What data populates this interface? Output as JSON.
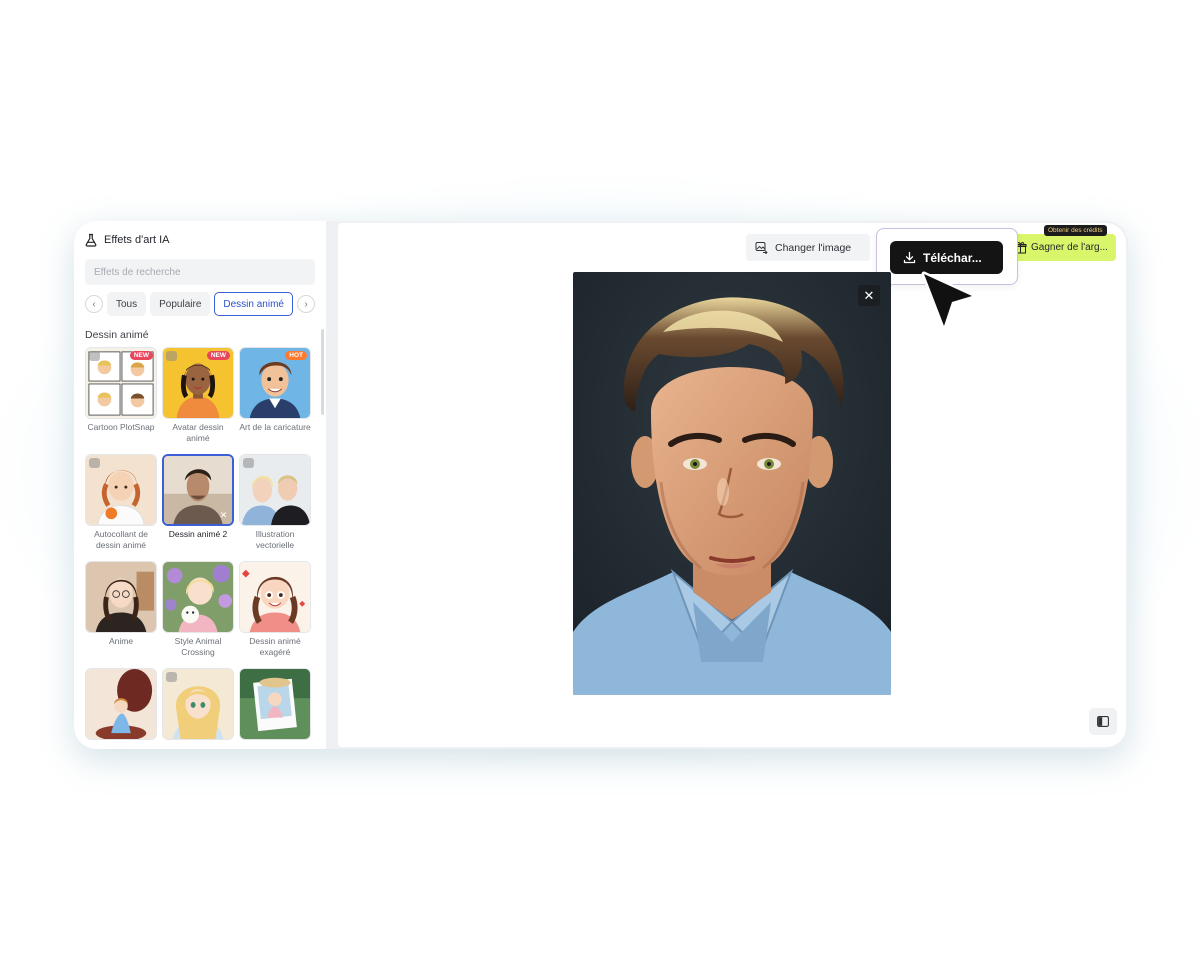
{
  "sidebar": {
    "title": "Effets d'art IA",
    "search_placeholder": "Effets de recherche",
    "tabs": [
      "Tous",
      "Populaire",
      "Dessin animé"
    ],
    "section_label": "Dessin animé",
    "items": [
      {
        "label": "Cartoon PlotSnap",
        "badge": "NEW"
      },
      {
        "label": "Avatar dessin animé",
        "badge": "NEW"
      },
      {
        "label": "Art de la caricature",
        "badge": "HOT"
      },
      {
        "label": "Autocollant de dessin animé"
      },
      {
        "label": "Dessin animé 2",
        "selected": true
      },
      {
        "label": "Illustration vectorielle"
      },
      {
        "label": "Anime"
      },
      {
        "label": "Style Animal Crossing"
      },
      {
        "label": "Dessin animé exagéré"
      },
      {
        "label": ""
      },
      {
        "label": ""
      },
      {
        "label": ""
      }
    ]
  },
  "toolbar": {
    "change_image_label": "Changer l'image",
    "download_label": "Téléchar...",
    "earn_label": "Gagner de l'arg...",
    "credits_tag": "Obtenir des crédits"
  },
  "colors": {
    "accent": "#3b5fd6",
    "earn_bg": "#d9f56a",
    "download_bg": "#141414"
  },
  "icons": {
    "header": "flask-icon",
    "change": "image-swap-icon",
    "download": "download-icon",
    "earn": "gift-icon",
    "close": "close-icon",
    "panel": "panel-toggle-icon"
  }
}
